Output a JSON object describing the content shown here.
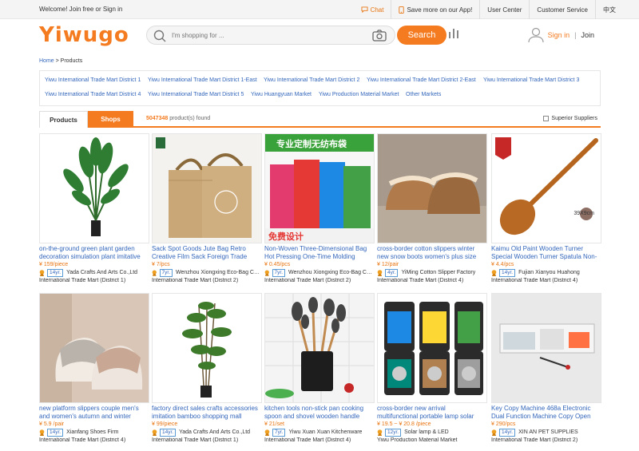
{
  "topbar": {
    "welcome": "Welcome! Join free or Sign in",
    "links": [
      "Chat",
      "Save more on our App!",
      "User Center",
      "Customer Service",
      "中文"
    ]
  },
  "header": {
    "logo": "Yiwugo",
    "search_placeholder": "I'm shopping for ...",
    "search_button": "Search",
    "signin": "Sign in",
    "separator": "|",
    "join": "Join"
  },
  "breadcrumb": {
    "home": "Home",
    "sep": " > ",
    "current": "Products"
  },
  "markets": {
    "row1": [
      "Yiwu International Trade Mart District 1",
      "Yiwu International Trade Mart District 1-East",
      "Yiwu International Trade Mart District 2",
      "Yiwu International Trade Mart District 2-East",
      "Yiwu International Trade Mart District 3"
    ],
    "row2": [
      "Yiwu International Trade Mart District 4",
      "Yiwu International Trade Mart District 5",
      "Yiwu Huangyuan Market",
      "Yiwu Production Material Market",
      "Other Markets"
    ]
  },
  "tabs": {
    "products": "Products",
    "shops": "Shops",
    "count": "5047348",
    "found_suffix": " product(s) found",
    "superior": "Superior Suppliers"
  },
  "colors": {
    "accent": "#f47b20",
    "link": "#3366bb"
  },
  "products": [
    {
      "title": "on-the-ground green plant garden decoration simulation plant imitative",
      "price": "¥ 159/piece",
      "years": "14yr.",
      "supplier": "Yada Crafts And Arts Co.,Ltd",
      "market": "International Trade Mart (District 1)"
    },
    {
      "title": "Sack Spot Goods Jute Bag Retro Creative Film Sack Foreign Trade",
      "price": "¥ 7/pcs",
      "years": "7yr.",
      "supplier": "Wenzhou Xiongxing Eco-Bag Co.,Ltd",
      "market": "International Trade Mart (District 2)"
    },
    {
      "title": "Non-Woven Three-Dimensional Bag Hot Pressing One-Time Molding",
      "price": "¥ 0.45/pcs",
      "years": "7yr.",
      "supplier": "Wenzhou Xiongxing Eco-Bag Co.,Ltd",
      "market": "International Trade Mart (District 2)",
      "img_text": "专业定制无纺布袋",
      "img_text2": "免费设计"
    },
    {
      "title": "cross-border cotton slippers winter new snow boots women's plus size",
      "price": "¥ 12/pair",
      "years": "4yr.",
      "supplier": "YiMing Cotton Slipper Factory",
      "market": "International Trade Mart (District 4)"
    },
    {
      "title": "Kaimu Old Paint Wooden Turner Special Wooden Turner Spatula Non-",
      "price": "¥ 4.4/pcs",
      "years": "14yr.",
      "supplier": "Fujian Xianyou Huahong",
      "market": "International Trade Mart (District 4)",
      "img_text": "39X9cm"
    },
    {
      "title": "new platform slippers couple men's and women's autumn and winter",
      "price": "¥ 5.9 /pair",
      "years": "14yr.",
      "supplier": "Xianfang Shoes Firm",
      "market": "International Trade Mart (District 4)"
    },
    {
      "title": "factory direct sales crafts accessories imitation bamboo shopping mall",
      "price": "¥ 99/piece",
      "years": "14yr.",
      "supplier": "Yada Crafts And Arts Co.,Ltd",
      "market": "International Trade Mart (District 1)"
    },
    {
      "title": "kitchen tools non-stick pan cooking spoon and shovel wooden handle",
      "price": "¥ 21/set",
      "years": "7yr.",
      "supplier": "Yiwu Xuan Xuan Kitchenware",
      "market": "International Trade Mart (District 4)"
    },
    {
      "title": "cross-border new arrival multifunctional portable lamp solar",
      "price": "¥ 19.5 ~ ¥ 20.8 /piece",
      "years": "12yr.",
      "supplier": "Solar lamp & LED",
      "market": "Yiwu Production Material Market"
    },
    {
      "title": "Key Copy Machine 468a Electronic Dual Function Machine Copy Open",
      "price": "¥ 290/pcs",
      "years": "14yr.",
      "supplier": "XIN AN PET SUPPLIES",
      "market": "International Trade Mart (District 2)"
    }
  ]
}
